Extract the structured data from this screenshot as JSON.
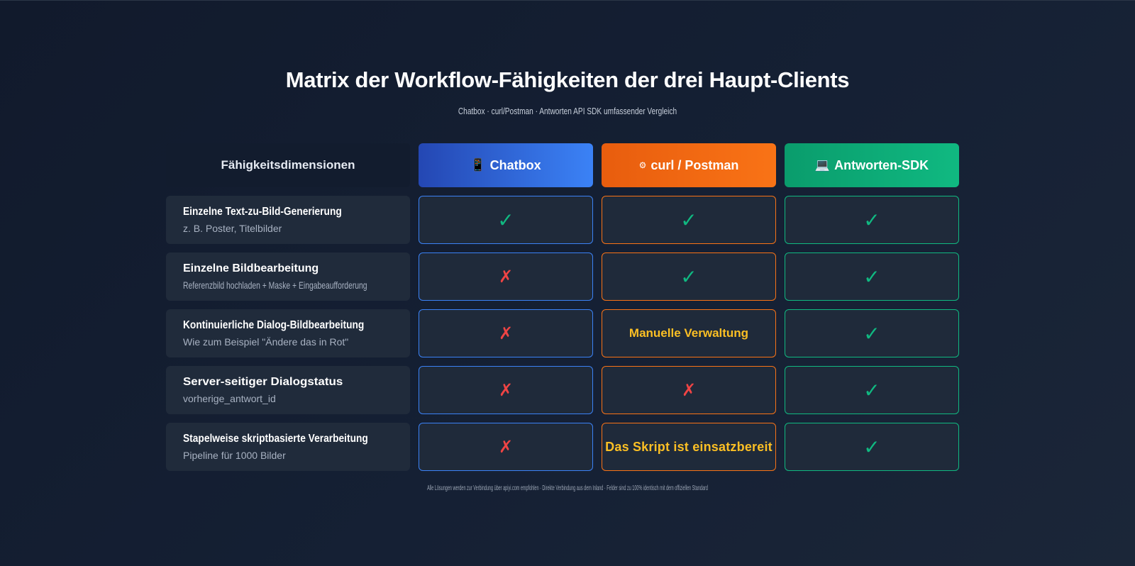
{
  "page": {
    "title": "Matrix der Workflow-Fähigkeiten der drei Haupt-Clients",
    "subtitle": "Chatbox · curl/Postman · Antworten API SDK umfassender Vergleich",
    "footnote": "Alle Lösungen werden zur Verbindung über apiyi.com empfohlen · Direkte Verbindung aus dem Inland · Felder sind zu 100% identisch mit dem offiziellen Standard"
  },
  "header": {
    "dimension_label": "Fähigkeitsdimensionen",
    "columns": [
      {
        "icon": "mobile-phone-icon",
        "glyph": "📱",
        "label": "Chatbox",
        "color": "#3b82f6"
      },
      {
        "icon": "gear-icon",
        "glyph": "⚙",
        "label": "curl / Postman",
        "color": "#f97316"
      },
      {
        "icon": "laptop-icon",
        "glyph": "💻",
        "label": "Antworten-SDK",
        "color": "#10b981"
      }
    ]
  },
  "marks": {
    "yes": "✓",
    "no": "✗",
    "yes_color": "#10b981",
    "no_color": "#ef4444",
    "note_color": "#fbbf24"
  },
  "rows": [
    {
      "title": "Einzelne Text-zu-Bild-Generierung",
      "subtitle": "z. B. Poster, Titelbilder",
      "values": [
        {
          "type": "yes",
          "text": "✓"
        },
        {
          "type": "yes",
          "text": "✓"
        },
        {
          "type": "yes",
          "text": "✓"
        }
      ]
    },
    {
      "title": "Einzelne Bildbearbeitung",
      "subtitle": "Referenzbild hochladen + Maske + Eingabeaufforderung",
      "values": [
        {
          "type": "no",
          "text": "✗"
        },
        {
          "type": "yes",
          "text": "✓"
        },
        {
          "type": "yes",
          "text": "✓"
        }
      ]
    },
    {
      "title": "Kontinuierliche Dialog-Bildbearbeitung",
      "subtitle": "Wie zum Beispiel \"Ändere das in Rot\"",
      "values": [
        {
          "type": "no",
          "text": "✗"
        },
        {
          "type": "note",
          "text": "Manuelle Verwaltung"
        },
        {
          "type": "yes",
          "text": "✓"
        }
      ]
    },
    {
      "title": "Server-seitiger Dialogstatus",
      "subtitle": "vorherige_antwort_id",
      "values": [
        {
          "type": "no",
          "text": "✗"
        },
        {
          "type": "no",
          "text": "✗"
        },
        {
          "type": "yes",
          "text": "✓"
        }
      ]
    },
    {
      "title": "Stapelweise skriptbasierte Verarbeitung",
      "subtitle": "Pipeline für 1000 Bilder",
      "values": [
        {
          "type": "no",
          "text": "✗"
        },
        {
          "type": "note",
          "text": "Das Skript ist einsatzbereit"
        },
        {
          "type": "yes",
          "text": "✓"
        }
      ]
    }
  ]
}
